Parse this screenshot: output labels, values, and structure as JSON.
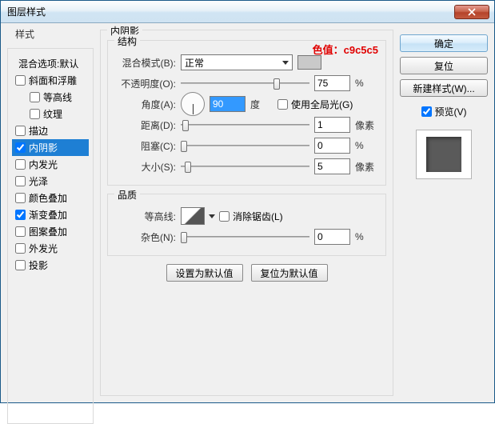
{
  "window": {
    "title": "图层样式"
  },
  "left": {
    "heading": "样式",
    "blend_options": "混合选项:默认",
    "items": [
      {
        "label": "斜面和浮雕",
        "checked": false,
        "indent": false
      },
      {
        "label": "等高线",
        "checked": false,
        "indent": true
      },
      {
        "label": "纹理",
        "checked": false,
        "indent": true
      },
      {
        "label": "描边",
        "checked": false,
        "indent": false
      },
      {
        "label": "内阴影",
        "checked": true,
        "indent": false,
        "selected": true
      },
      {
        "label": "内发光",
        "checked": false,
        "indent": false
      },
      {
        "label": "光泽",
        "checked": false,
        "indent": false
      },
      {
        "label": "颜色叠加",
        "checked": false,
        "indent": false
      },
      {
        "label": "渐变叠加",
        "checked": true,
        "indent": false
      },
      {
        "label": "图案叠加",
        "checked": false,
        "indent": false
      },
      {
        "label": "外发光",
        "checked": false,
        "indent": false
      },
      {
        "label": "投影",
        "checked": false,
        "indent": false
      }
    ]
  },
  "mid": {
    "heading": "内阴影",
    "annotation": "色值：c9c5c5",
    "structure": {
      "heading": "结构",
      "blend_mode_label": "混合模式(B):",
      "blend_mode_value": "正常",
      "color": "#c9c9c9",
      "opacity_label": "不透明度(O):",
      "opacity_value": "75",
      "opacity_unit": "%",
      "angle_label": "角度(A):",
      "angle_value": "90",
      "angle_unit": "度",
      "global_light": "使用全局光(G)",
      "distance_label": "距离(D):",
      "distance_value": "1",
      "distance_unit": "像素",
      "choke_label": "阻塞(C):",
      "choke_value": "0",
      "choke_unit": "%",
      "size_label": "大小(S):",
      "size_value": "5",
      "size_unit": "像素"
    },
    "quality": {
      "heading": "品质",
      "contour_label": "等高线:",
      "antialias": "消除锯齿(L)",
      "noise_label": "杂色(N):",
      "noise_value": "0",
      "noise_unit": "%"
    },
    "buttons": {
      "default": "设置为默认值",
      "reset": "复位为默认值"
    }
  },
  "right": {
    "ok": "确定",
    "reset": "复位",
    "new_style": "新建样式(W)...",
    "preview": "预览(V)"
  }
}
